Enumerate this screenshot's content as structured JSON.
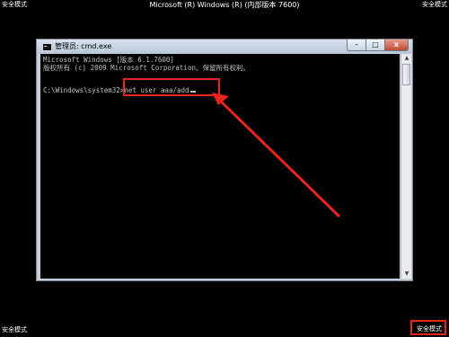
{
  "safe_mode": {
    "top_left": "安全模式",
    "top_right": "安全模式",
    "bottom_left": "安全模式",
    "bottom_right": "安全模式"
  },
  "screen_title": "Microsoft (R) Windows (R) (内部版本 7600)",
  "window": {
    "title": "管理员: cmd.exe",
    "minimize_glyph": "–",
    "maximize_glyph": "□",
    "close_glyph": "x"
  },
  "console": {
    "line1": "Microsoft Windows [版本 6.1.7600]",
    "line2": "版权所有 (c) 2009 Microsoft Corporation。保留所有权利。",
    "prompt": "C:\\Windows\\system32>",
    "command": "net user aaa/add"
  },
  "scrollbar": {
    "up_glyph": "▲",
    "down_glyph": "▼"
  },
  "annotation": {
    "color": "#e8261e"
  }
}
